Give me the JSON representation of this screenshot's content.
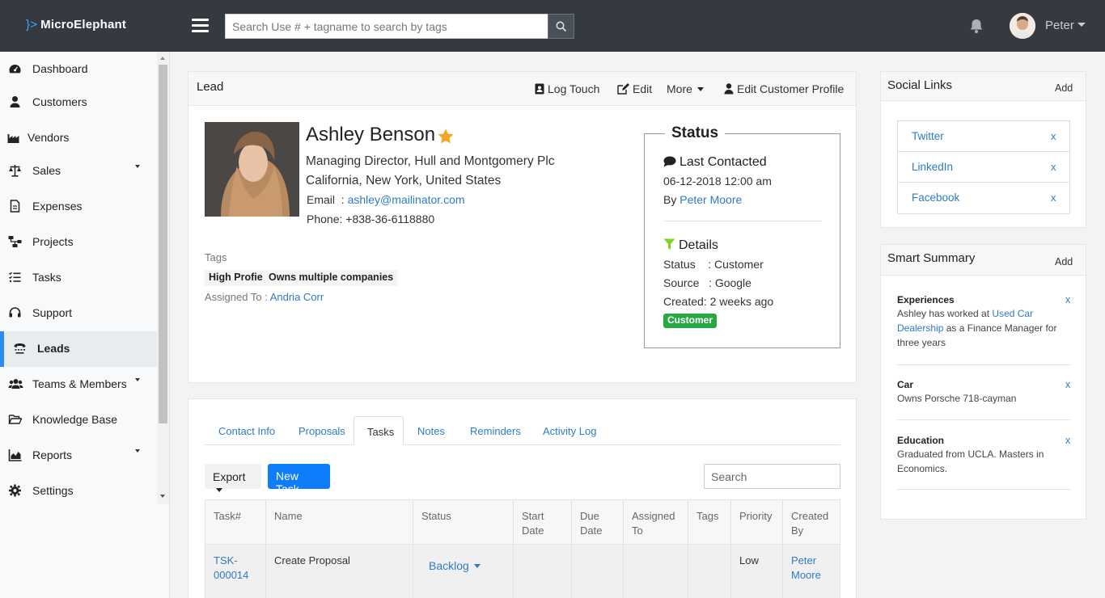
{
  "app": {
    "name": "MicroElephant"
  },
  "search": {
    "placeholder": "Search Use # + tagname to search by tags"
  },
  "user": {
    "name": "Peter"
  },
  "sidebar": {
    "items": [
      {
        "label": "Dashboard",
        "icon": "dashboard-icon"
      },
      {
        "label": "Customers",
        "icon": "user-icon"
      },
      {
        "label": "Vendors",
        "icon": "industry-icon"
      },
      {
        "label": "Sales",
        "icon": "balance-scale-icon"
      },
      {
        "label": "Expenses",
        "icon": "file-icon"
      },
      {
        "label": "Projects",
        "icon": "sitemap-icon"
      },
      {
        "label": "Tasks",
        "icon": "tasks-icon"
      },
      {
        "label": "Support",
        "icon": "headset-icon"
      },
      {
        "label": "Leads",
        "icon": "tty-icon"
      },
      {
        "label": "Teams & Members",
        "icon": "users-icon"
      },
      {
        "label": "Knowledge Base",
        "icon": "folder-open-icon"
      },
      {
        "label": "Reports",
        "icon": "chart-area-icon"
      },
      {
        "label": "Settings",
        "icon": "gear-icon"
      }
    ]
  },
  "lead": {
    "header_title": "Lead",
    "actions": {
      "log_touch": "Log Touch",
      "edit": "Edit",
      "more": "More",
      "edit_customer": "Edit Customer Profile"
    },
    "name": "Ashley Benson",
    "title_line": "Managing Director, Hull and Montgomery Plc",
    "location": "California, New York, United States",
    "email_label": "Email",
    "email": "ashley@mailinator.com",
    "phone_label": "Phone",
    "phone": "+838-36-6118880",
    "tags_label": "Tags",
    "tags": [
      "High Profie",
      "Owns multiple companies"
    ],
    "assigned_label": "Assigned To :",
    "assigned_to": "Andria Corr"
  },
  "status_box": {
    "title": "Status",
    "last_contacted_label": "Last Contacted",
    "last_contacted_date": "06-12-2018 12:00 am",
    "by_label": "By",
    "by_name": "Peter Moore",
    "details_label": "Details",
    "status_row": {
      "label": "Status",
      "value": "Customer"
    },
    "source_row": {
      "label": "Source",
      "value": "Google"
    },
    "created_row": {
      "label": "Created",
      "value": "2 weeks ago"
    },
    "badge": "Customer",
    "badge_color": "#28a745"
  },
  "tabs": [
    "Contact Info",
    "Proposals",
    "Tasks",
    "Notes",
    "Reminders",
    "Activity Log"
  ],
  "active_tab": "Tasks",
  "task_toolbar": {
    "export": "Export",
    "new_task": "New Task",
    "search_placeholder": "Search"
  },
  "task_table": {
    "headers": [
      "Task#",
      "Name",
      "Status",
      "Start Date",
      "Due Date",
      "Assigned To",
      "Tags",
      "Priority",
      "Created By"
    ],
    "rows": [
      {
        "task": "TSK-000014",
        "name": "Create Proposal",
        "status": "Backlog",
        "start": "",
        "due": "",
        "assigned": "",
        "tags": "",
        "priority": "Low",
        "created_by": "Peter Moore"
      }
    ]
  },
  "social_links": {
    "title": "Social Links",
    "add": "Add",
    "items": [
      {
        "label": "Twitter",
        "remove": "x"
      },
      {
        "label": "LinkedIn",
        "remove": "x"
      },
      {
        "label": "Facebook",
        "remove": "x"
      }
    ]
  },
  "smart_summary": {
    "title": "Smart Summary",
    "add": "Add",
    "items": [
      {
        "heading": "Experiences",
        "text_before": "Ashley has worked at ",
        "link": "Used Car Dealership",
        "text_after": " as a Finance Manager for three years",
        "remove": "x"
      },
      {
        "heading": "Car",
        "text": "Owns Porsche 718-cayman",
        "remove": "x"
      },
      {
        "heading": "Education",
        "text": "Graduated from UCLA. Masters in Economics.",
        "remove": "x"
      }
    ]
  },
  "colors": {
    "topbar": "#343a40",
    "accent": "#2a8cf0",
    "link": "#2f7bc4",
    "primary_button": "#0d7dfc",
    "star": "#f5a623",
    "filter_icon": "#7ed321"
  }
}
